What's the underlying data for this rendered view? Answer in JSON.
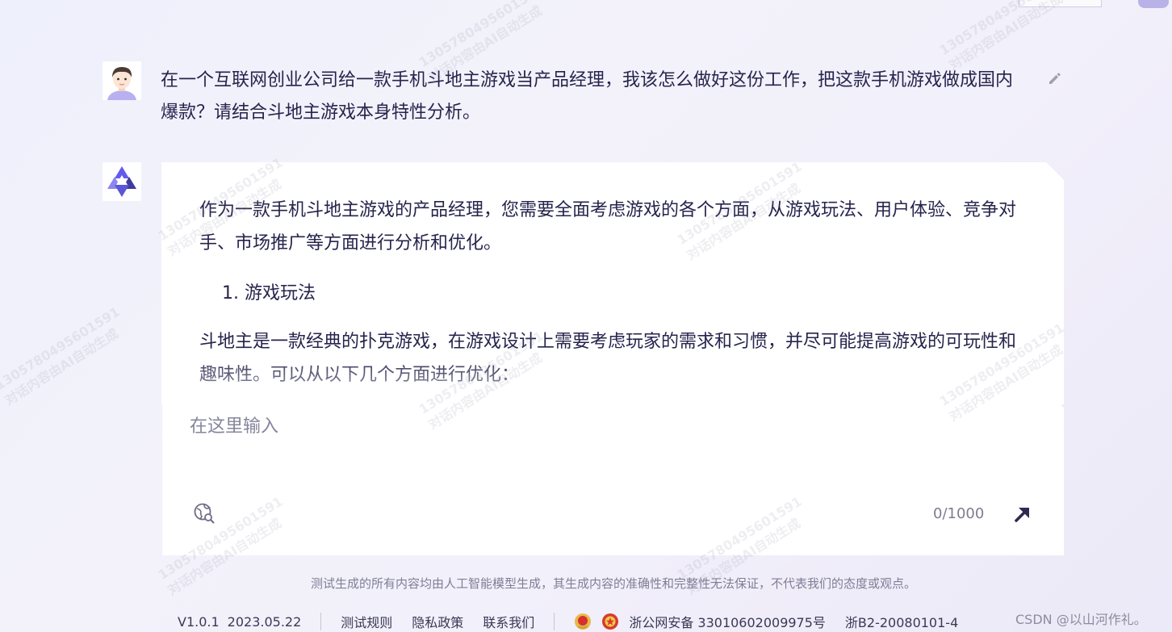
{
  "chat": {
    "user_message": "在一个互联网创业公司给一款手机斗地主游戏当产品经理，我该怎么做好这份工作，把这款手机游戏做成国内爆款？请结合斗地主游戏本身特性分析。",
    "bot_response": {
      "intro": "作为一款手机斗地主游戏的产品经理，您需要全面考虑游戏的各个方面，从游戏玩法、用户体验、竞争对手、市场推广等方面进行分析和优化。",
      "list_item_1": "1. 游戏玩法",
      "paragraph_2": "斗地主是一款经典的扑克游戏，在游戏设计上需要考虑玩家的需求和习惯，并尽可能提高游戏的可玩性和趣味性。可以从以下几个方面进行优化："
    }
  },
  "input": {
    "placeholder": "在这里输入",
    "value": "",
    "char_count": "0/1000"
  },
  "disclaimer": "测试生成的所有内容均由人工智能模型生成，其生成内容的准确性和完整性无法保证，不代表我们的态度或观点。",
  "footer": {
    "version": "V1.0.1",
    "date": "2023.05.22",
    "test_rules": "测试规则",
    "privacy_policy": "隐私政策",
    "contact_us": "联系我们",
    "police_record": "浙公网安备 33010602009975号",
    "icp": "浙B2-20080101-4"
  },
  "csdn_credit": "CSDN @以山河作礼。",
  "watermark": {
    "line1": "13057804956015​91",
    "line2": "对话内容由AI自动生成"
  },
  "icons": {
    "user_avatar": "cartoon-man-avatar",
    "bot_avatar": "tongyi-star-logo",
    "edit": "pencil-icon",
    "web_search": "globe-search-icon",
    "send": "arrow-up-right-icon"
  },
  "colors": {
    "accent": "#615ced",
    "text": "#26244c",
    "muted": "#86859c",
    "send": "#2d2b52"
  }
}
